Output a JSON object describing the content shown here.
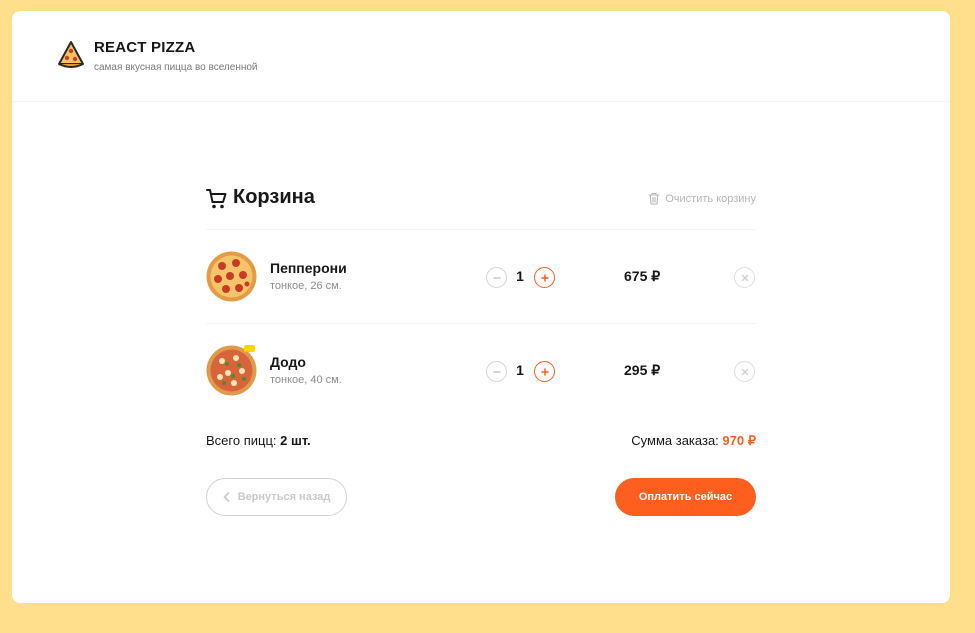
{
  "header": {
    "title": "REACT PIZZA",
    "subtitle": "самая вкусная пицца во вселенной"
  },
  "cart": {
    "title": "Корзина",
    "clear_label": "Очистить корзину",
    "items": [
      {
        "name": "Пепперони",
        "desc": "тонкое, 26 см.",
        "count": "1",
        "price": "675 ₽",
        "minus": "−",
        "plus": "+"
      },
      {
        "name": "Додо",
        "desc": "тонкое, 40 см.",
        "count": "1",
        "price": "295 ₽",
        "minus": "−",
        "plus": "+"
      }
    ],
    "total_count_label": "Всего пицц:",
    "total_count": "2 шт.",
    "total_sum_label": "Сумма заказа:",
    "total_sum": "970 ₽",
    "back_label": "Вернуться назад",
    "pay_label": "Оплатить сейчас"
  },
  "colors": {
    "accent": "#FE5F1E",
    "background": "#FFDF8C",
    "card": "#FFFFFF"
  }
}
